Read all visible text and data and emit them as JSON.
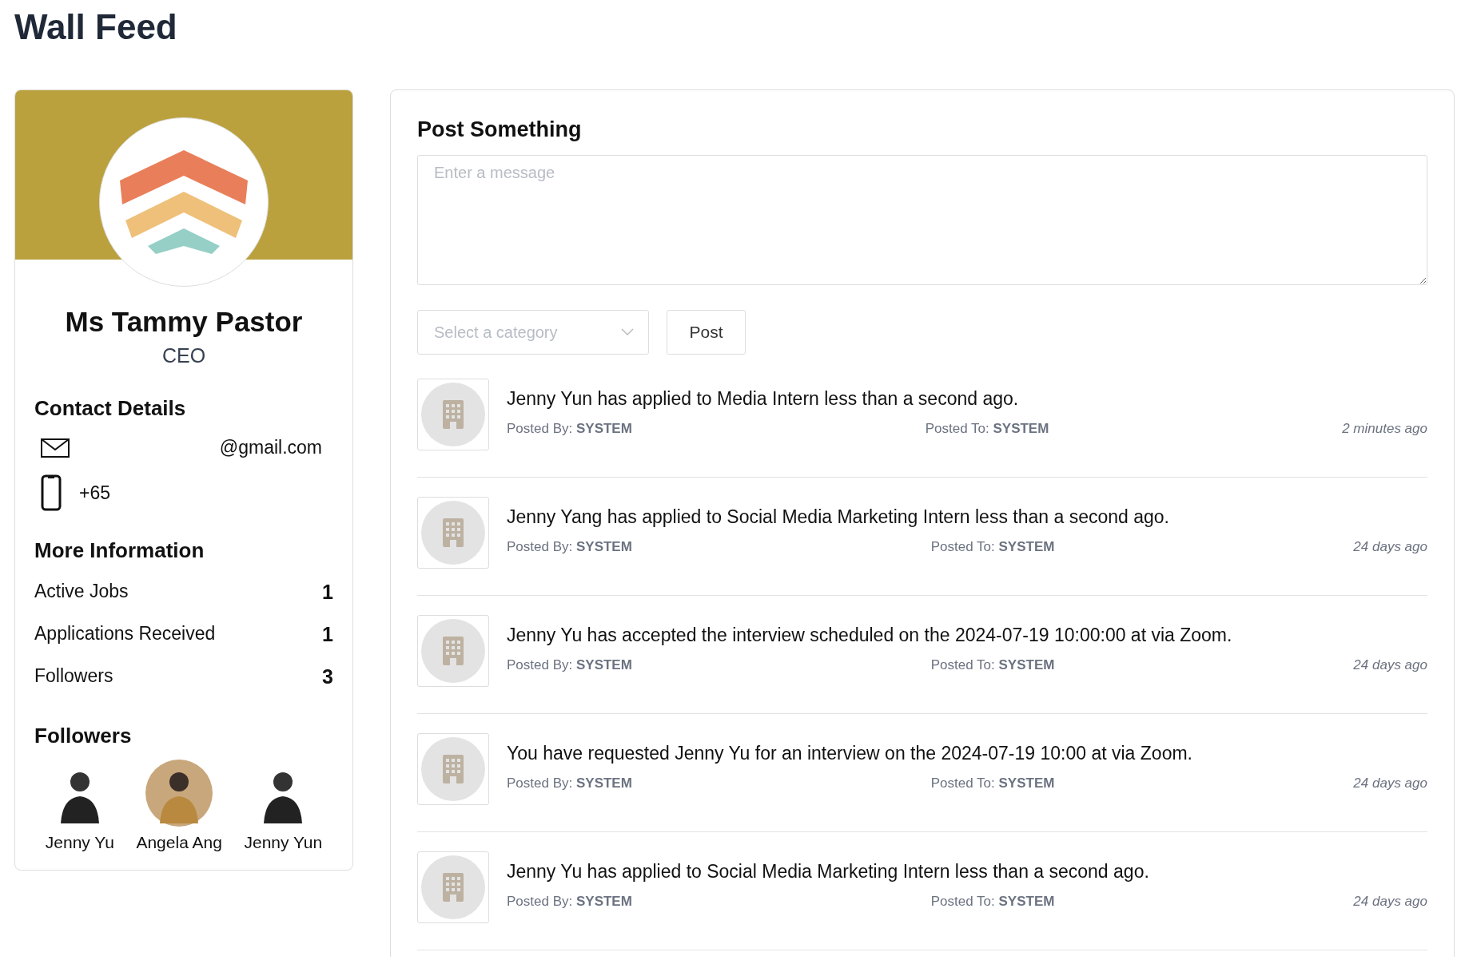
{
  "page_title": "Wall Feed",
  "profile": {
    "name": "Ms Tammy Pastor",
    "role": "CEO",
    "contact_heading": "Contact Details",
    "email": "@gmail.com",
    "phone": "+65",
    "info_heading": "More Information",
    "stats": [
      {
        "label": "Active Jobs",
        "value": "1"
      },
      {
        "label": "Applications Received",
        "value": "1"
      },
      {
        "label": "Followers",
        "value": "3"
      }
    ],
    "followers_heading": "Followers",
    "followers": [
      {
        "name": "Jenny Yu"
      },
      {
        "name": "Angela Ang"
      },
      {
        "name": "Jenny Yun"
      }
    ]
  },
  "composer": {
    "heading": "Post Something",
    "placeholder": "Enter a message",
    "category_placeholder": "Select a category",
    "post_button": "Post"
  },
  "feed": [
    {
      "message": "Jenny Yun has applied to Media Intern less than a second ago.",
      "posted_by_label": "Posted By:",
      "posted_by": "SYSTEM",
      "posted_to_label": "Posted To:",
      "posted_to": "SYSTEM",
      "time": "2 minutes ago"
    },
    {
      "message": "Jenny Yang has applied to Social Media Marketing Intern less than a second ago.",
      "posted_by_label": "Posted By:",
      "posted_by": "SYSTEM",
      "posted_to_label": "Posted To:",
      "posted_to": "SYSTEM",
      "time": "24 days ago"
    },
    {
      "message": "Jenny Yu has accepted the interview scheduled on the 2024-07-19 10:00:00 at via Zoom.",
      "posted_by_label": "Posted By:",
      "posted_by": "SYSTEM",
      "posted_to_label": "Posted To:",
      "posted_to": "SYSTEM",
      "time": "24 days ago"
    },
    {
      "message": "You have requested Jenny Yu for an interview on the 2024-07-19 10:00 at via Zoom.",
      "posted_by_label": "Posted By:",
      "posted_by": "SYSTEM",
      "posted_to_label": "Posted To:",
      "posted_to": "SYSTEM",
      "time": "24 days ago"
    },
    {
      "message": "Jenny Yu has applied to Social Media Marketing Intern less than a second ago.",
      "posted_by_label": "Posted By:",
      "posted_by": "SYSTEM",
      "posted_to_label": "Posted To:",
      "posted_to": "SYSTEM",
      "time": "24 days ago"
    }
  ]
}
